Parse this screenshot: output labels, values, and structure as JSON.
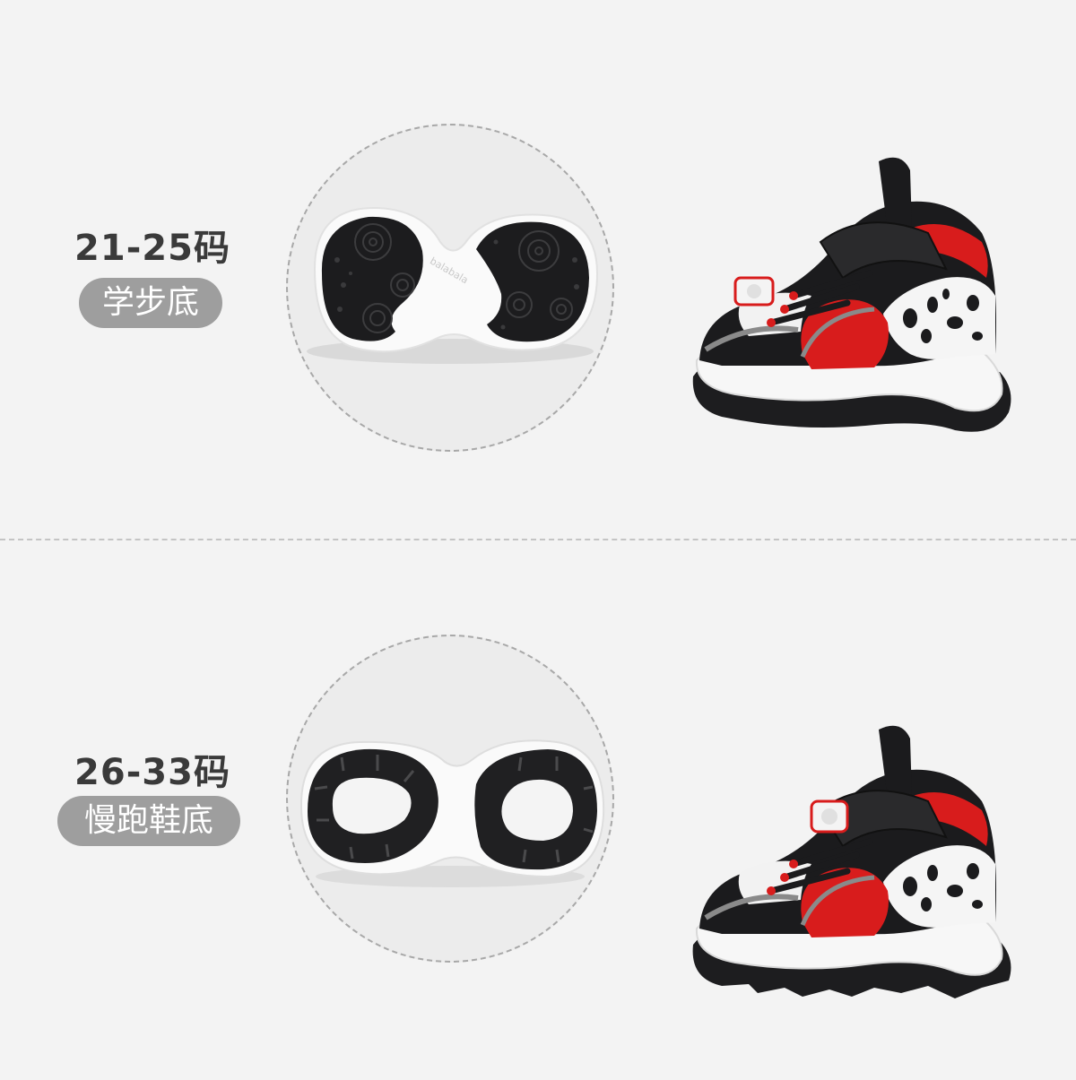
{
  "variants": [
    {
      "size_range": "21-25码",
      "sole_type": "学步底",
      "sole_image": "rounded-black-sole-image",
      "shoe_image": "sneaker-side-view-image",
      "brand_mark": "balabala"
    },
    {
      "size_range": "26-33码",
      "sole_type": "慢跑鞋底",
      "sole_image": "lugged-running-sole-image",
      "shoe_image": "sneaker-side-view-image"
    }
  ],
  "colors": {
    "background": "#f3f3f3",
    "circle_fill": "#ececec",
    "badge": "#9e9e9e",
    "label_text": "#3a3a3a",
    "shoe_black": "#1b1b1d",
    "shoe_red": "#d81c1c",
    "shoe_white": "#f7f7f7"
  }
}
